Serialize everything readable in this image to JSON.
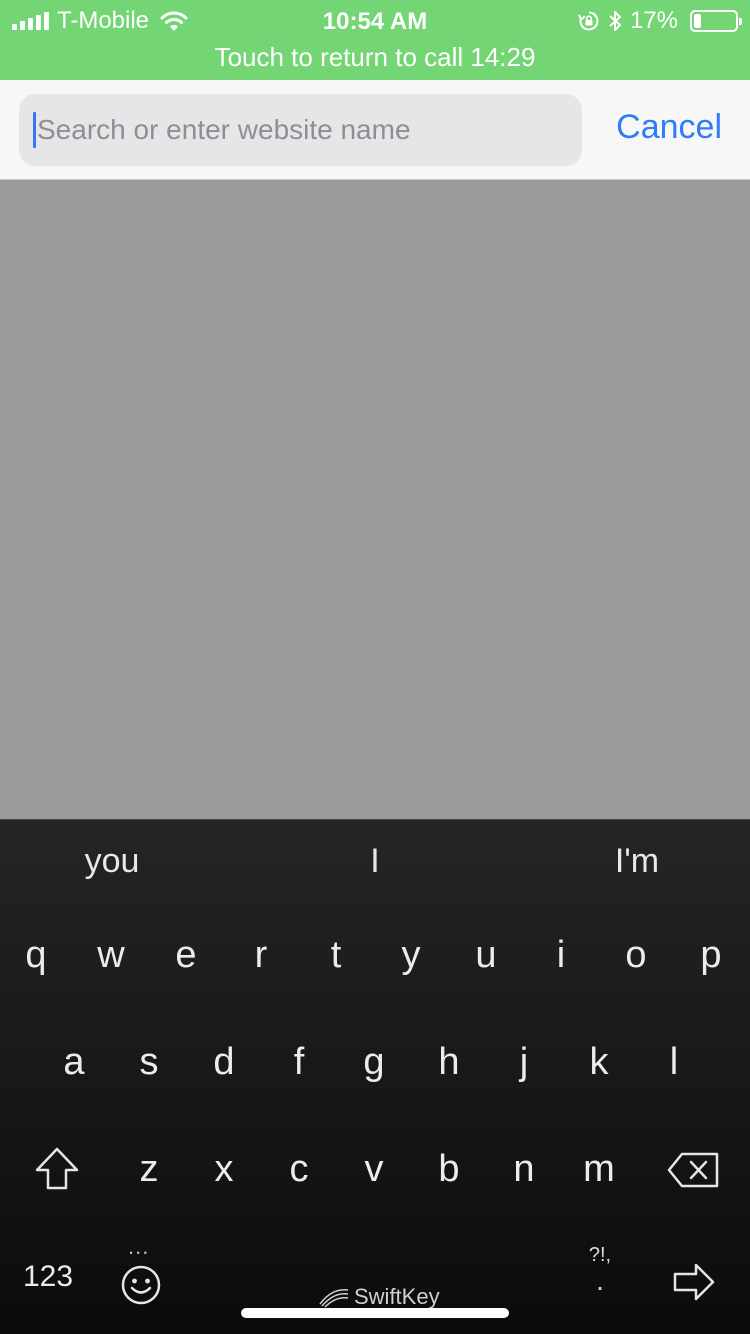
{
  "status_bar": {
    "carrier": "T-Mobile",
    "time": "10:54 AM",
    "battery_percent": "17%",
    "battery_level": 0.17,
    "call_banner": "Touch to return to call 14:29",
    "icons": [
      "signal-icon",
      "wifi-icon",
      "rotation-lock-icon",
      "bluetooth-icon",
      "battery-icon"
    ]
  },
  "search": {
    "placeholder": "Search or enter website name",
    "value": "",
    "cancel_label": "Cancel"
  },
  "keyboard": {
    "suggestions": [
      "you",
      "I",
      "I'm"
    ],
    "row1": [
      "q",
      "w",
      "e",
      "r",
      "t",
      "y",
      "u",
      "i",
      "o",
      "p"
    ],
    "row2": [
      "a",
      "s",
      "d",
      "f",
      "g",
      "h",
      "j",
      "k",
      "l"
    ],
    "row3": [
      "z",
      "x",
      "c",
      "v",
      "b",
      "n",
      "m"
    ],
    "numbers_label": "123",
    "emoji_dots": "...",
    "punct_top": "?!,",
    "punct_bottom": ".",
    "brand": "SwiftKey"
  },
  "colors": {
    "status_bar_bg": "#74d574",
    "accent": "#2f7cf6",
    "content_bg": "#9a9a9a",
    "keyboard_bg": "#1a1a1a"
  }
}
